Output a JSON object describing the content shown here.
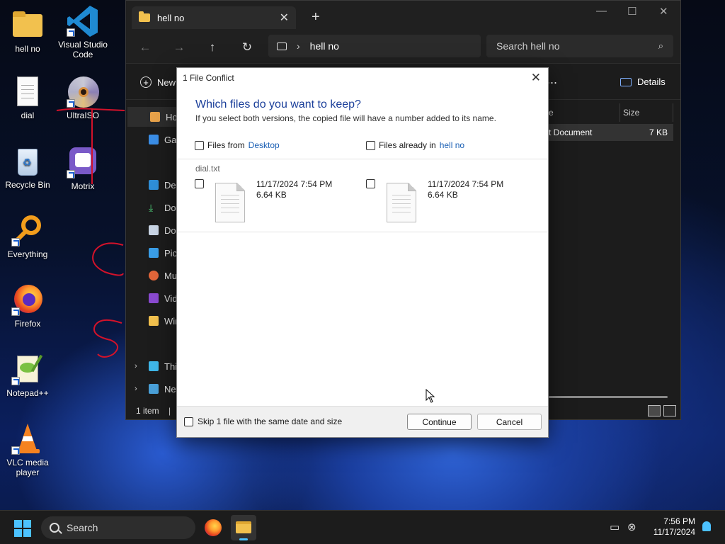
{
  "desktop": {
    "icons": [
      {
        "label": "hell no"
      },
      {
        "label": "Visual Studio Code"
      },
      {
        "label": "dial"
      },
      {
        "label": "UltraISO"
      },
      {
        "label": "Recycle Bin"
      },
      {
        "label": "Motrix"
      },
      {
        "label": "Everything"
      },
      {
        "label": "Firefox"
      },
      {
        "label": "Notepad++"
      },
      {
        "label": "VLC media player"
      }
    ]
  },
  "explorer": {
    "tab_title": "hell no",
    "address": "hell no",
    "search_placeholder": "Search hell no",
    "new_label": "New",
    "more_label": "...",
    "details_label": "Details",
    "sidebar": [
      "Ho",
      "Gal",
      "Des",
      "Dov",
      "Doc",
      "Pict",
      "Mu",
      "Vid",
      "Win",
      "Thi",
      "Net"
    ],
    "columns": {
      "type": "e",
      "size": "Size"
    },
    "row": {
      "type": "t Document",
      "size": "7 KB"
    },
    "status": "1 item",
    "status_sep": "|"
  },
  "dialog": {
    "title": "1 File Conflict",
    "heading": "Which files do you want to keep?",
    "subtitle": "If you select both versions, the copied file will have a number added to its name.",
    "source": {
      "prefix": "Files from",
      "link": "Desktop"
    },
    "destination": {
      "prefix": "Files already in",
      "link": "hell no"
    },
    "file_name": "dial.txt",
    "left_file": {
      "date": "11/17/2024 7:54 PM",
      "size": "6.64 KB"
    },
    "right_file": {
      "date": "11/17/2024 7:54 PM",
      "size": "6.64 KB"
    },
    "skip_label": "Skip 1 file with the same date and size",
    "continue_label": "Continue",
    "cancel_label": "Cancel"
  },
  "taskbar": {
    "search_placeholder": "Search",
    "time": "7:56 PM",
    "date": "11/17/2024"
  },
  "colors": {
    "accent": "#4cc2ff",
    "dialog_heading": "#1b3f9a",
    "link": "#1a5fb4"
  }
}
